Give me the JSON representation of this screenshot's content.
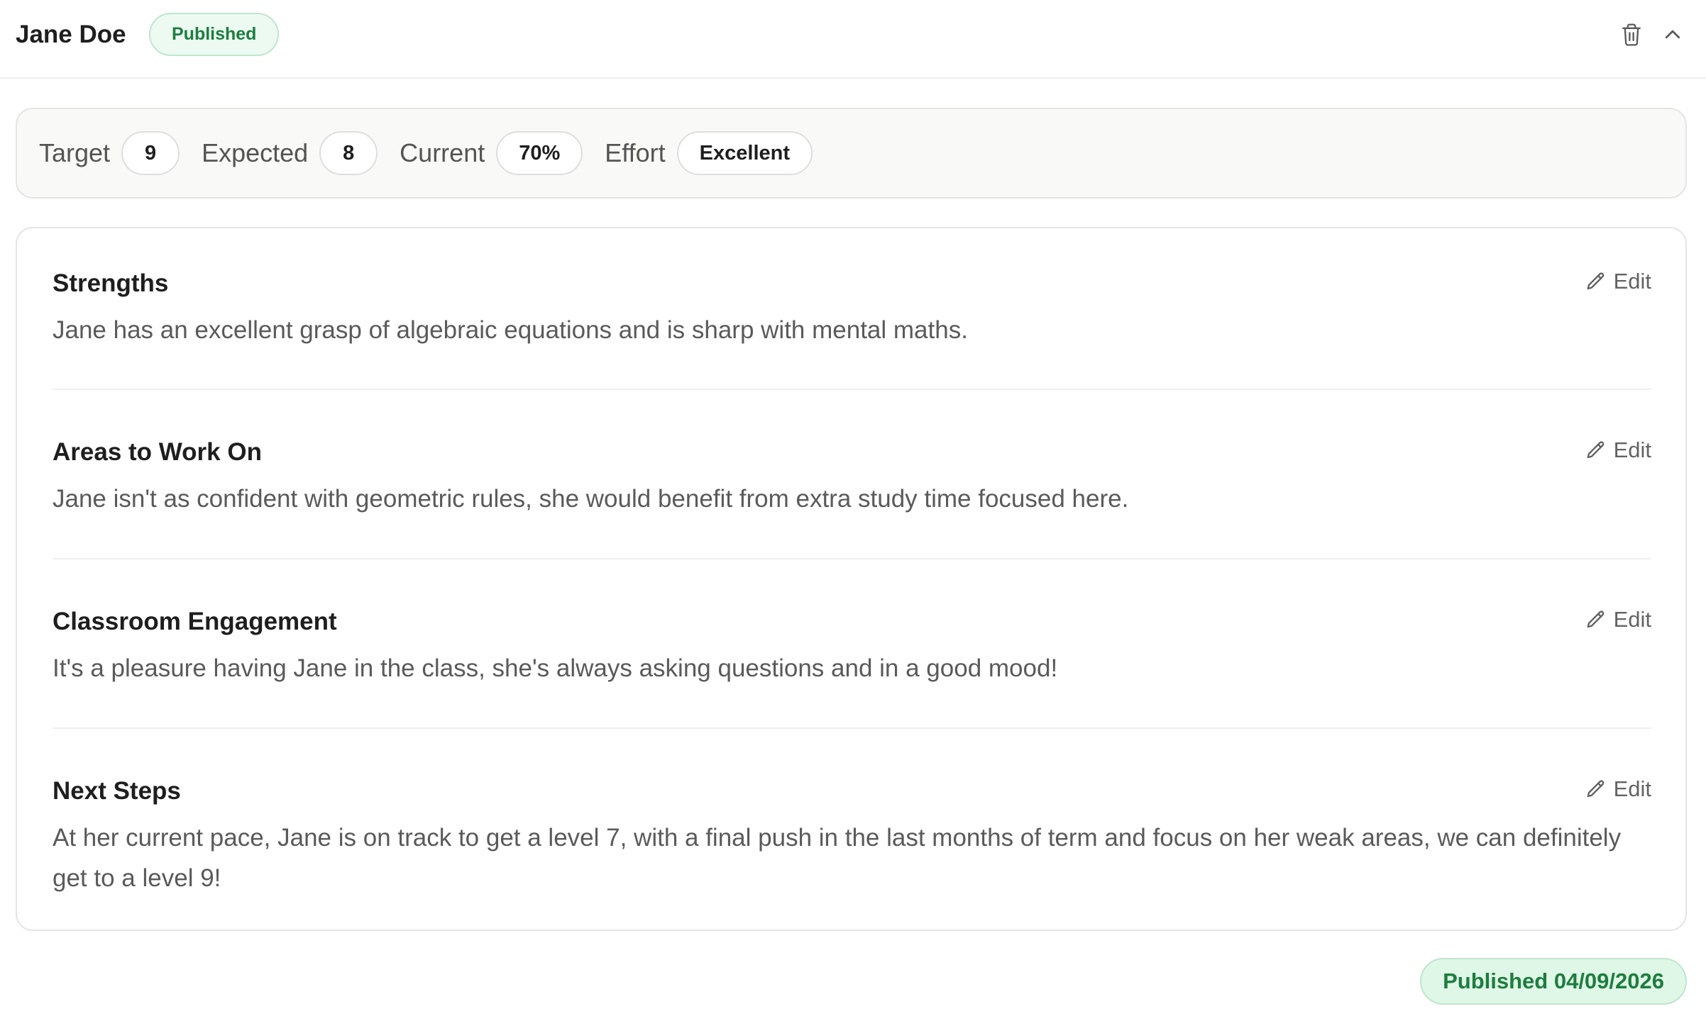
{
  "header": {
    "student_name": "Jane Doe",
    "status": "Published",
    "delete_icon": "trash-icon",
    "collapse_icon": "chevron-up-icon"
  },
  "grades": [
    {
      "label": "Target",
      "value": "9"
    },
    {
      "label": "Expected",
      "value": "8"
    },
    {
      "label": "Current",
      "value": "70%"
    },
    {
      "label": "Effort",
      "value": "Excellent"
    }
  ],
  "sections": [
    {
      "title": "Strengths",
      "text": "Jane has an excellent grasp of algebraic equations and is sharp with mental maths.",
      "edit_label": "Edit"
    },
    {
      "title": "Areas to Work On",
      "text": "Jane isn't as confident with geometric rules, she would benefit from extra study time focused here.",
      "edit_label": "Edit"
    },
    {
      "title": "Classroom Engagement",
      "text": "It's a pleasure having Jane in the class, she's always asking questions and in a good mood!",
      "edit_label": "Edit"
    },
    {
      "title": "Next Steps",
      "text": "At her current pace, Jane is on track to get a level 7, with a final push in the last months of term and focus on her weak areas, we can definitely get to a level 9!",
      "edit_label": "Edit"
    }
  ],
  "footer": {
    "published_label": "Published 04/09/2026"
  },
  "colors": {
    "published_text": "#1d7d3e",
    "published_bg": "#ecfaf1",
    "published_border": "#bfe6cd"
  }
}
